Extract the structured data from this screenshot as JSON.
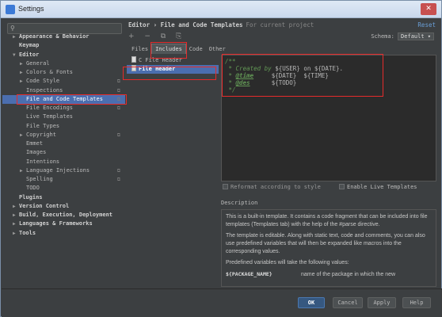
{
  "window": {
    "title": "Settings",
    "close_glyph": "✕"
  },
  "sidebar": {
    "search_placeholder": "",
    "items": [
      {
        "label": "Appearance & Behavior",
        "arrow": "▶",
        "bold": true,
        "level": 0
      },
      {
        "label": "Keymap",
        "arrow": "",
        "bold": true,
        "level": 0
      },
      {
        "label": "Editor",
        "arrow": "▼",
        "bold": true,
        "level": 0
      },
      {
        "label": "General",
        "arrow": "▶",
        "bold": false,
        "level": 1
      },
      {
        "label": "Colors & Fonts",
        "arrow": "▶",
        "bold": false,
        "level": 1
      },
      {
        "label": "Code Style",
        "arrow": "▶",
        "bold": false,
        "level": 1,
        "copy": true
      },
      {
        "label": "Inspections",
        "arrow": "",
        "bold": false,
        "level": 1,
        "copy": true
      },
      {
        "label": "File and Code Templates",
        "arrow": "",
        "bold": false,
        "level": 1,
        "copy": true,
        "selected": true
      },
      {
        "label": "File Encodings",
        "arrow": "",
        "bold": false,
        "level": 1,
        "copy": true
      },
      {
        "label": "Live Templates",
        "arrow": "",
        "bold": false,
        "level": 1
      },
      {
        "label": "File Types",
        "arrow": "",
        "bold": false,
        "level": 1
      },
      {
        "label": "Copyright",
        "arrow": "▶",
        "bold": false,
        "level": 1,
        "copy": true
      },
      {
        "label": "Emmet",
        "arrow": "",
        "bold": false,
        "level": 1
      },
      {
        "label": "Images",
        "arrow": "",
        "bold": false,
        "level": 1
      },
      {
        "label": "Intentions",
        "arrow": "",
        "bold": false,
        "level": 1
      },
      {
        "label": "Language Injections",
        "arrow": "▶",
        "bold": false,
        "level": 1,
        "copy": true
      },
      {
        "label": "Spelling",
        "arrow": "",
        "bold": false,
        "level": 1,
        "copy": true
      },
      {
        "label": "TODO",
        "arrow": "",
        "bold": false,
        "level": 1
      },
      {
        "label": "Plugins",
        "arrow": "",
        "bold": true,
        "level": 0
      },
      {
        "label": "Version Control",
        "arrow": "▶",
        "bold": true,
        "level": 0
      },
      {
        "label": "Build, Execution, Deployment",
        "arrow": "▶",
        "bold": true,
        "level": 0
      },
      {
        "label": "Languages & Frameworks",
        "arrow": "▶",
        "bold": true,
        "level": 0
      },
      {
        "label": "Tools",
        "arrow": "▶",
        "bold": true,
        "level": 0
      }
    ]
  },
  "header": {
    "breadcrumb": "Editor › File and Code Templates",
    "project_note": "For current project",
    "reset_label": "Reset",
    "schema_label": "Schema:",
    "schema_value": "Default"
  },
  "toolbar": {
    "icons": "+ − ⧉ ⎘"
  },
  "tabs": [
    {
      "label": "Files",
      "active": false
    },
    {
      "label": "Includes",
      "active": true
    },
    {
      "label": "Code",
      "active": false
    },
    {
      "label": "Other",
      "active": false
    }
  ],
  "templates": [
    {
      "label": "C File Header",
      "selected": false
    },
    {
      "label": "File Header",
      "selected": true
    }
  ],
  "editor": {
    "lines": [
      {
        "a": "/**",
        "tag": "",
        "b": ""
      },
      {
        "a": " * Created by ",
        "tag": "",
        "b": "${USER} on ${DATE}."
      },
      {
        "a": " * ",
        "tag": "@time",
        "b": "     ${DATE}  ${TIME}"
      },
      {
        "a": " * ",
        "tag": "@des",
        "b": "      ${TODO}"
      },
      {
        "a": " */",
        "tag": "",
        "b": ""
      }
    ]
  },
  "options": {
    "reformat": "Reformat according to style",
    "live_templates": "Enable Live Templates"
  },
  "description": {
    "label": "Description",
    "p1": "This is a built-in template. It contains a code fragment that can be included into file templates (Templates tab) with the help of the #parse directive.",
    "p2": "The template is editable. Along with static text, code and comments, you can also use predefined variables that will then be expanded like macros into the corresponding values.",
    "p3": "Predefined variables will take the following values:",
    "var_name": "${PACKAGE_NAME}",
    "var_desc": "name of the package in which the new"
  },
  "buttons": {
    "ok": "OK",
    "cancel": "Cancel",
    "apply": "Apply",
    "help": "Help"
  },
  "colors": {
    "background": "#3c3f41",
    "selection": "#4b6eaf",
    "annotation": "#e52b2b",
    "comment": "#629755"
  }
}
